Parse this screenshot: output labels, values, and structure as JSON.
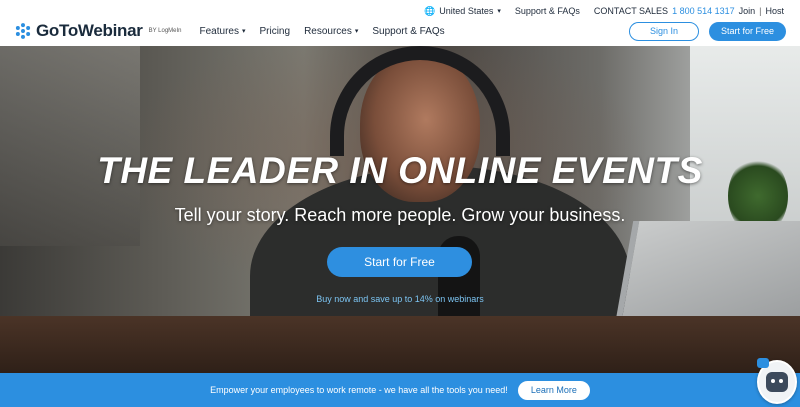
{
  "utility": {
    "country": "United States",
    "support": "Support & FAQs",
    "contact_label": "CONTACT SALES",
    "phone": "1 800 514 1317",
    "join": "Join",
    "separator": "|",
    "host": "Host"
  },
  "nav": {
    "logo": "GoToWebinar",
    "logo_sub": "BY LogMeIn",
    "menu": [
      {
        "label": "Features",
        "has_caret": true
      },
      {
        "label": "Pricing",
        "has_caret": false
      },
      {
        "label": "Resources",
        "has_caret": true
      },
      {
        "label": "Support & FAQs",
        "has_caret": false
      }
    ],
    "signin": "Sign In",
    "start_free": "Start for Free"
  },
  "hero": {
    "title": "THE LEADER IN ONLINE EVENTS",
    "subtitle": "Tell your story. Reach more people. Grow your business.",
    "cta": "Start for Free",
    "promo": "Buy now and save up to 14% on webinars"
  },
  "banner": {
    "text": "Empower your employees to work remote - we have all the tools you need!",
    "button": "Learn More"
  },
  "colors": {
    "accent": "#2c8fe0",
    "nav_text": "#1e2a3a",
    "banner_bg": "#2c8fe0"
  },
  "icons": {
    "globe": "globe-icon",
    "caret": "chevron-down-icon",
    "logo_mark": "snowflake-logo-icon",
    "chat": "chatbot-icon"
  }
}
